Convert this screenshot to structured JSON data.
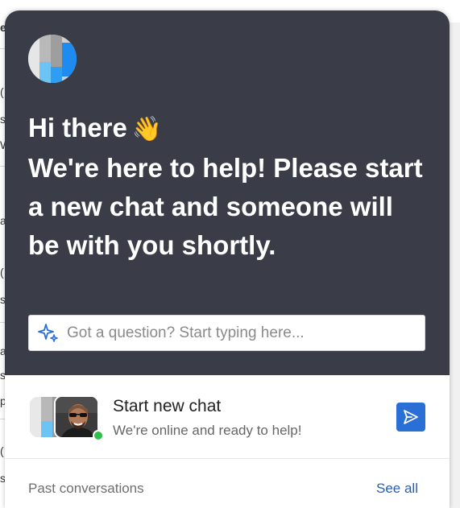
{
  "background_page": {
    "fragments": [
      {
        "text": "e"
      },
      {
        "text": "("
      },
      {
        "text": "s"
      },
      {
        "text": "W"
      },
      {
        "text": "a"
      },
      {
        "text": "("
      },
      {
        "text": "s"
      },
      {
        "text": "a"
      },
      {
        "text": "s"
      },
      {
        "text": "p"
      },
      {
        "text": "("
      },
      {
        "text": "s"
      }
    ]
  },
  "widget": {
    "logo_icon": "company-logo",
    "greeting_line1": "Hi there",
    "greeting_emoji": "👋",
    "greeting_message": "We're here to help! Please start a new chat and someone will be with you shortly.",
    "ask_box": {
      "icon": "sparkle-icon",
      "placeholder": "Got a question? Start typing here..."
    },
    "start_chat": {
      "title": "Start new chat",
      "subtitle": "We're online and ready to help!",
      "status": "online",
      "send_icon": "send-icon"
    },
    "past_conversations": {
      "title": "Past conversations",
      "link": "See all"
    },
    "colors": {
      "header_bg": "#3a3d47",
      "accent": "#2a6fd6",
      "online": "#2fbf4a",
      "sparkle": "#2a6fd6"
    }
  }
}
